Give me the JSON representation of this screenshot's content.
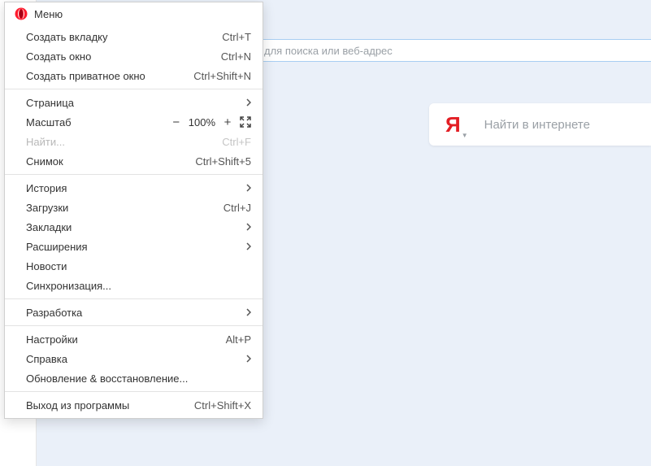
{
  "menu": {
    "title": "Меню",
    "groups": [
      [
        {
          "label": "Создать вкладку",
          "shortcut": "Ctrl+T"
        },
        {
          "label": "Создать окно",
          "shortcut": "Ctrl+N"
        },
        {
          "label": "Создать приватное окно",
          "shortcut": "Ctrl+Shift+N"
        }
      ],
      [
        {
          "label": "Страница",
          "submenu": true
        },
        {
          "label": "Масштаб",
          "zoom": true,
          "zoom_level": "100%"
        },
        {
          "label": "Найти...",
          "shortcut": "Ctrl+F",
          "disabled": true
        },
        {
          "label": "Снимок",
          "shortcut": "Ctrl+Shift+5"
        }
      ],
      [
        {
          "label": "История",
          "submenu": true
        },
        {
          "label": "Загрузки",
          "shortcut": "Ctrl+J"
        },
        {
          "label": "Закладки",
          "submenu": true
        },
        {
          "label": "Расширения",
          "submenu": true
        },
        {
          "label": "Новости"
        },
        {
          "label": "Синхронизация..."
        }
      ],
      [
        {
          "label": "Разработка",
          "submenu": true
        }
      ],
      [
        {
          "label": "Настройки",
          "shortcut": "Alt+P"
        },
        {
          "label": "Справка",
          "submenu": true
        },
        {
          "label": "Обновление & восстановление..."
        }
      ],
      [
        {
          "label": "Выход из программы",
          "shortcut": "Ctrl+Shift+X"
        }
      ]
    ]
  },
  "addressbar": {
    "placeholder": "для поиска или веб-адрес"
  },
  "search": {
    "logo": "Я",
    "placeholder": "Найти в интернете"
  }
}
